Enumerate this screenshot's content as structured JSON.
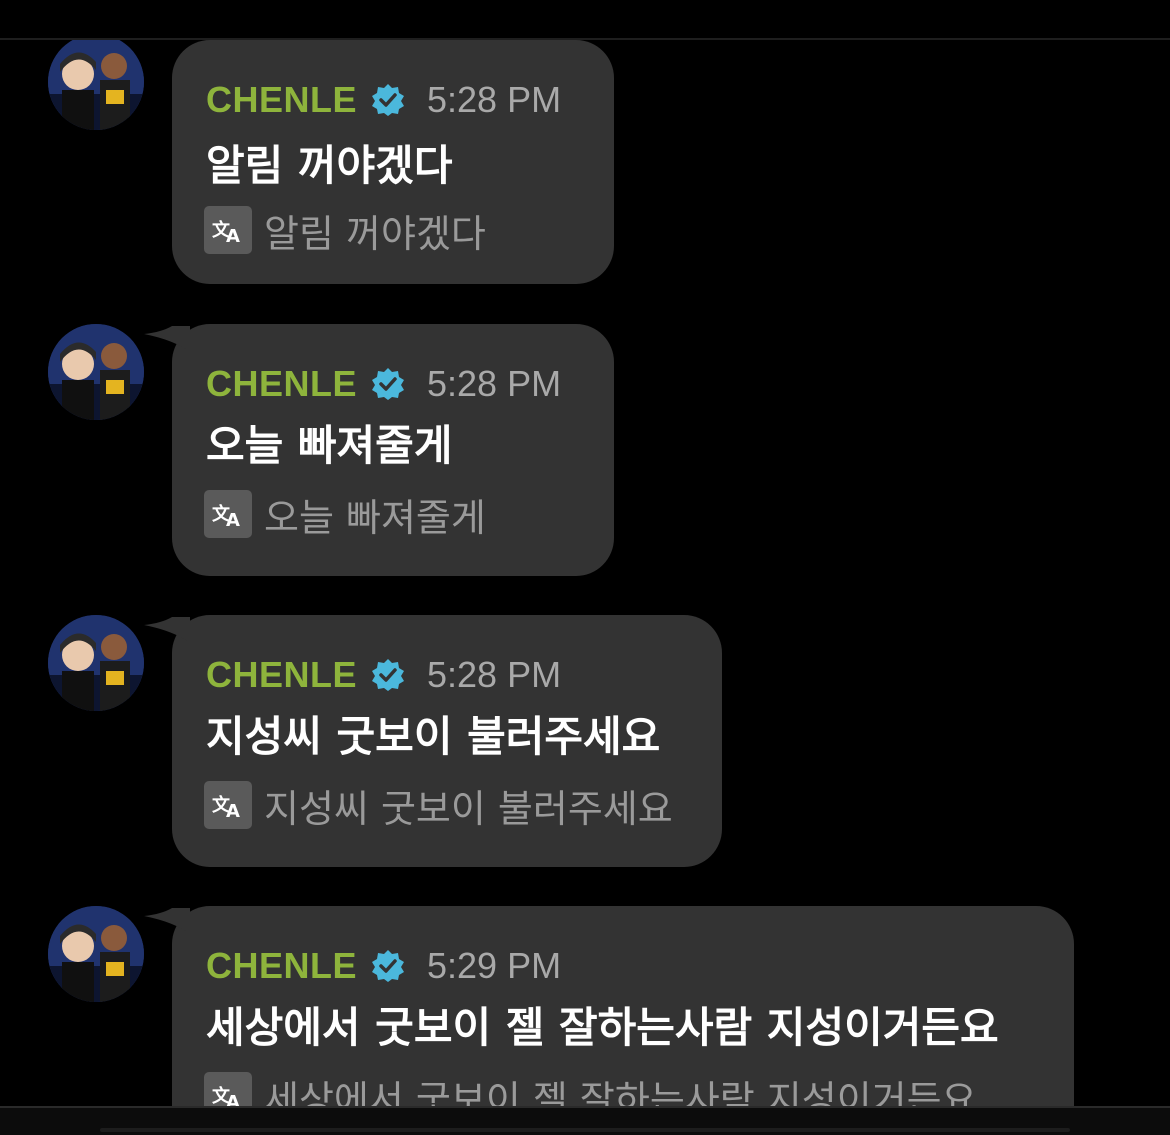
{
  "colors": {
    "background": "#000000",
    "bubble": "#333333",
    "sender": "#8eb43c",
    "verified": "#4bb8dc",
    "time": "#a9a9a9",
    "message": "#ffffff",
    "translation": "#9a9a9a"
  },
  "messages": [
    {
      "sender": "CHENLE",
      "time": "5:28 PM",
      "text": "알림 꺼야겠다",
      "translation": "알림 꺼야겠다"
    },
    {
      "sender": "CHENLE",
      "time": "5:28 PM",
      "text": "오늘 빠져줄게",
      "translation": "오늘 빠져줄게"
    },
    {
      "sender": "CHENLE",
      "time": "5:28 PM",
      "text": "지성씨 굿보이 불러주세요",
      "translation": "지성씨 굿보이 불러주세요"
    },
    {
      "sender": "CHENLE",
      "time": "5:29 PM",
      "text": "세상에서 굿보이 젤 잘하는사람 지성이거든요",
      "translation": "세상에서 굿보이 젤 잘하는사람 지성이거든요"
    }
  ],
  "icons": {
    "verified": "verified-badge-icon",
    "translate": "translate-icon",
    "avatar": "profile-photo"
  }
}
